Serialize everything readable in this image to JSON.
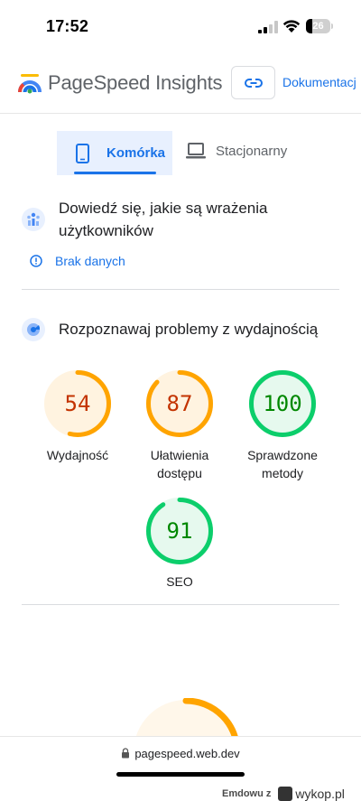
{
  "status_bar": {
    "time": "17:52",
    "battery": "26",
    "battery_level": 0.26
  },
  "header": {
    "brand": "PageSpeed Insights",
    "docs_link": "Dokumentacj",
    "logo_icon": "pagespeed-logo-icon",
    "link_icon": "link-icon"
  },
  "tabs": [
    {
      "label": "Komórka",
      "icon": "smartphone-icon",
      "selected": true
    },
    {
      "label": "Stacjonarny",
      "icon": "laptop-icon",
      "selected": false
    }
  ],
  "field_data": {
    "title": "Dowiedź się, jakie są wrażenia użytkowników",
    "icon": "users-chart-icon",
    "no_data_icon": "info-icon",
    "no_data_label": "Brak danych"
  },
  "lab_data": {
    "title": "Rozpoznawaj problemy z wydajnością",
    "icon": "lighthouse-icon",
    "scores": [
      {
        "value": "54",
        "score": 54,
        "label": "Wydajność",
        "status": "average"
      },
      {
        "value": "87",
        "score": 87,
        "label": "Ułatwienia dostępu",
        "status": "average"
      },
      {
        "value": "100",
        "score": 100,
        "label": "Sprawdzone metody",
        "status": "good"
      },
      {
        "value": "91",
        "score": 91,
        "label": "SEO",
        "status": "good"
      }
    ]
  },
  "colors": {
    "accent": "#1a73e8",
    "average_ring": "#ffa400",
    "average_text": "#c33300",
    "average_bg": "#fff3e0",
    "good_ring": "#0cce6b",
    "good_text": "#008800",
    "good_bg": "#e6f9ee"
  },
  "url_bar": {
    "url": "pagespeed.web.dev",
    "lock_icon": "lock-icon"
  },
  "watermark": {
    "author": "Emdowu z",
    "site": "wykop.pl"
  }
}
